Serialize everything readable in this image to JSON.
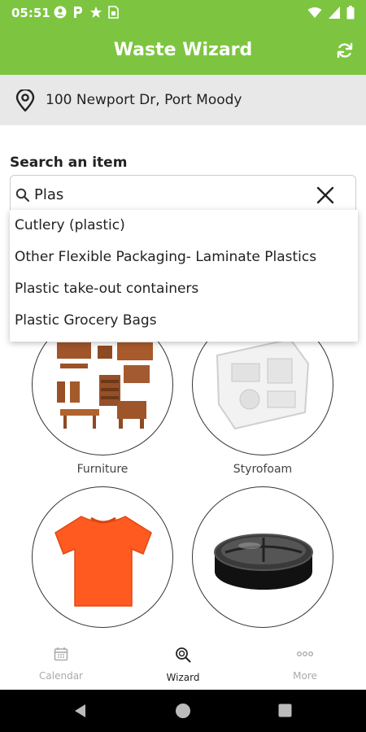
{
  "status_bar": {
    "time": "05:51"
  },
  "app_bar": {
    "title": "Waste Wizard"
  },
  "location": {
    "address": "100 Newport Dr, Port Moody"
  },
  "search": {
    "label": "Search an item",
    "value": "Plas"
  },
  "suggestions": [
    "Cutlery (plastic)",
    "Other Flexible Packaging- Laminate Plastics",
    "Plastic take-out containers",
    "Plastic Grocery Bags"
  ],
  "categories": [
    {
      "label": "Furniture",
      "icon": "furniture-image"
    },
    {
      "label": "Styrofoam",
      "icon": "styrofoam-image"
    },
    {
      "label": "",
      "icon": "tshirt-image"
    },
    {
      "label": "",
      "icon": "takeout-container-image"
    }
  ],
  "bottom_nav": {
    "calendar": "Calendar",
    "wizard": "Wizard",
    "more": "More"
  },
  "colors": {
    "accent": "#7dc540",
    "inactive_nav": "#aaaaaa"
  }
}
